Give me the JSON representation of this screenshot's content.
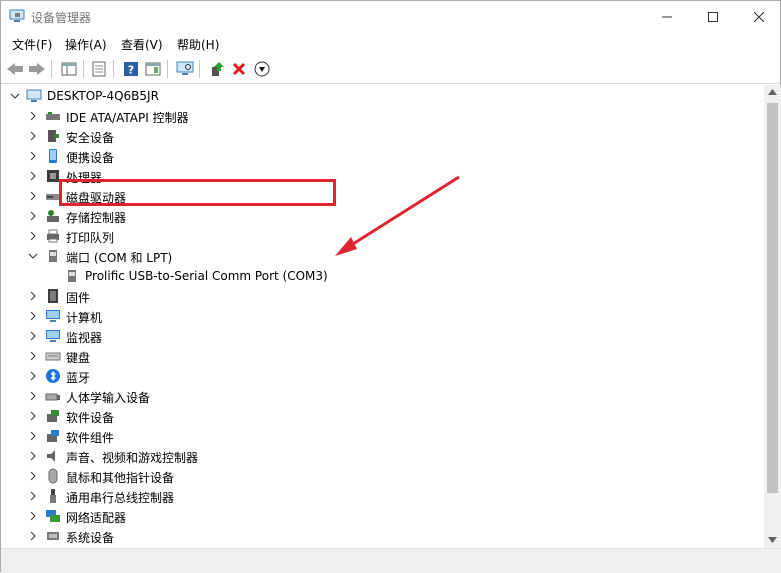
{
  "window": {
    "title": "设备管理器"
  },
  "menu": [
    "文件(F)",
    "操作(A)",
    "查看(V)",
    "帮助(H)"
  ],
  "tree": {
    "root": "DESKTOP-4Q6B5JR",
    "categories": [
      {
        "label": "IDE ATA/ATAPI 控制器",
        "icon": "ide-controller-icon"
      },
      {
        "label": "安全设备",
        "icon": "security-device-icon"
      },
      {
        "label": "便携设备",
        "icon": "portable-device-icon"
      },
      {
        "label": "处理器",
        "icon": "processor-icon"
      },
      {
        "label": "磁盘驱动器",
        "icon": "disk-drive-icon"
      },
      {
        "label": "存储控制器",
        "icon": "storage-controller-icon"
      },
      {
        "label": "打印队列",
        "icon": "print-queue-icon"
      },
      {
        "label": "端口 (COM 和 LPT)",
        "icon": "port-icon",
        "expanded": true,
        "children": [
          {
            "label": "Prolific USB-to-Serial Comm Port (COM3)",
            "icon": "serial-port-icon"
          }
        ]
      },
      {
        "label": "固件",
        "icon": "firmware-icon"
      },
      {
        "label": "计算机",
        "icon": "computer-icon"
      },
      {
        "label": "监视器",
        "icon": "monitor-icon"
      },
      {
        "label": "键盘",
        "icon": "keyboard-icon"
      },
      {
        "label": "蓝牙",
        "icon": "bluetooth-icon"
      },
      {
        "label": "人体学输入设备",
        "icon": "hid-icon"
      },
      {
        "label": "软件设备",
        "icon": "software-device-icon"
      },
      {
        "label": "软件组件",
        "icon": "software-component-icon"
      },
      {
        "label": "声音、视频和游戏控制器",
        "icon": "sound-icon"
      },
      {
        "label": "鼠标和其他指针设备",
        "icon": "mouse-icon"
      },
      {
        "label": "通用串行总线控制器",
        "icon": "usb-controller-icon"
      },
      {
        "label": "网络适配器",
        "icon": "network-adapter-icon"
      },
      {
        "label": "系统设备",
        "icon": "system-device-icon"
      }
    ]
  },
  "colors": {
    "annotation": "#e0242f",
    "selection_accent": "#0078d7"
  }
}
